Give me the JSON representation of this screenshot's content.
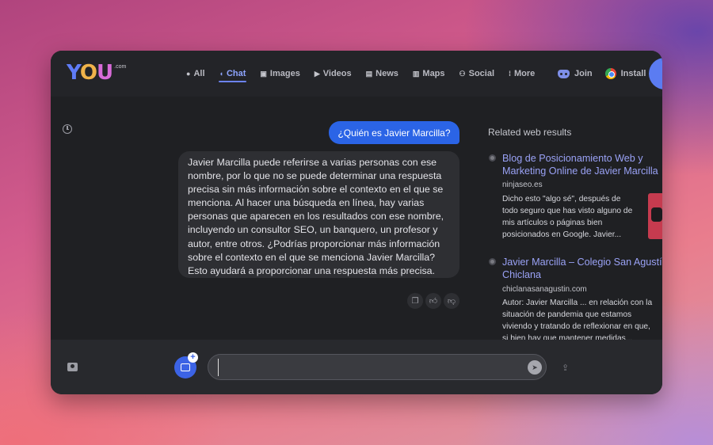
{
  "brand": {
    "logo_text_y": "Y",
    "logo_text_o": "O",
    "logo_text_u": "U",
    "logo_suffix": ".com"
  },
  "nav": {
    "items": [
      {
        "label": "All",
        "icon": "search-icon"
      },
      {
        "label": "Chat",
        "icon": "chat-icon",
        "active": true
      },
      {
        "label": "Images",
        "icon": "images-icon"
      },
      {
        "label": "Videos",
        "icon": "play-icon"
      },
      {
        "label": "News",
        "icon": "news-icon"
      },
      {
        "label": "Maps",
        "icon": "map-icon"
      },
      {
        "label": "Social",
        "icon": "people-icon"
      },
      {
        "label": "More",
        "icon": "grid-icon"
      }
    ],
    "join_label": "Join",
    "install_label": "Install"
  },
  "chat": {
    "user_message": "¿Quién es Javier Marcilla?",
    "bot_message": "Javier Marcilla puede referirse a varias personas con ese nombre, por lo que no se puede determinar una respuesta precisa sin más información sobre el contexto en el que se menciona. Al hacer una búsqueda en línea, hay varias personas que aparecen en los resultados con ese nombre, incluyendo un consultor SEO, un banquero, un profesor y autor, entre otros. ¿Podrías proporcionar más información sobre el contexto en el que se menciona Javier Marcilla? Esto ayudará a proporcionar una respuesta más precisa."
  },
  "related": {
    "heading": "Related web results",
    "results": [
      {
        "title_line1": "Blog de Posicionamiento Web y",
        "title_line2": "Marketing Online de Javier Marcilla",
        "domain": "ninjaseo.es",
        "snippet": "Dicho esto \"algo sé\", después de todo seguro que has visto alguno de mis artículos o páginas bien posicionados en Google. Javier..."
      },
      {
        "title_line1": "Javier Marcilla – Colegio San Agustín",
        "title_line2": "Chiclana",
        "domain": "chiclanasanagustin.com",
        "snippet": "Autor: Javier Marcilla ... en relación con la situación de pandemia que estamos viviendo y tratando de reflexionar en que, si bien hay que mantener medidas..."
      }
    ]
  },
  "composer": {
    "input_value": "",
    "input_placeholder": ""
  },
  "colors": {
    "accent": "#2b64e6",
    "link": "#9aa2f6",
    "window_bg": "#1f2023"
  }
}
